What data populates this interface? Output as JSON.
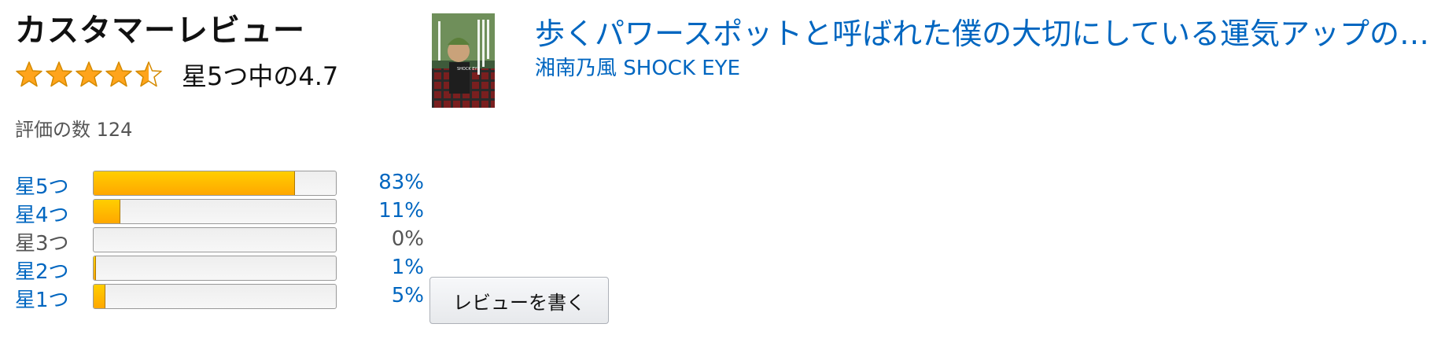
{
  "reviews": {
    "heading": "カスタマーレビュー",
    "rating_value": 4.7,
    "rating_text": "星5つ中の4.7",
    "count_text": "評価の数 124",
    "star_color": "#ffa41c",
    "histogram": [
      {
        "label": "星5つ",
        "percent_text": "83%",
        "percent": 83,
        "is_link": true
      },
      {
        "label": "星4つ",
        "percent_text": "11%",
        "percent": 11,
        "is_link": true
      },
      {
        "label": "星3つ",
        "percent_text": "0%",
        "percent": 0,
        "is_link": false
      },
      {
        "label": "星2つ",
        "percent_text": "1%",
        "percent": 1,
        "is_link": true
      },
      {
        "label": "星1つ",
        "percent_text": "5%",
        "percent": 5,
        "is_link": true
      }
    ]
  },
  "product": {
    "title": "歩くパワースポットと呼ばれた僕の大切にしている運気アップの習慣",
    "author": "湘南乃風 SHOCK EYE",
    "cover_text": "歩くパワースポットと呼ばれた僕の大切にしている運気アップの習慣",
    "cover_author": "SHOCK EYE"
  },
  "actions": {
    "write_review_label": "レビューを書く"
  },
  "colors": {
    "link": "#0066c0",
    "bar_fill": "#ffa700",
    "bar_empty": "#f3f3f3"
  }
}
